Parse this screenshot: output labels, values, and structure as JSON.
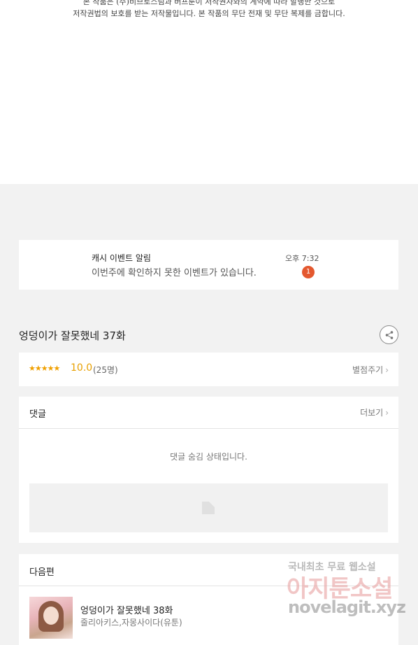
{
  "copyright": {
    "line1": "본 작품은 (주)비브로스팀과 버프툰이 저작권자와의 계약에 따라 발행한 것으로",
    "line2": "저작권법의 보호를 받는 저작물입니다. 본 작품의 무단 전재 및 무단 복제를 금합니다."
  },
  "notification": {
    "title": "캐시 이벤트 알림",
    "body": "이번주에 확인하지 못한 이벤트가 있습니다.",
    "time": "오후 7:32",
    "badge": "1"
  },
  "episode": {
    "title": "엉덩이가 잘못했네 37화",
    "share_icon": "share-icon"
  },
  "rating": {
    "stars": "★★★★★",
    "score": "10.0",
    "count": "(25명)",
    "rate_label": "별점주기",
    "chevron": "›"
  },
  "comments": {
    "heading": "댓글",
    "more_label": "더보기",
    "chevron": "›",
    "hidden_message": "댓글 숨김 상태입니다."
  },
  "next_episode": {
    "heading": "다음편",
    "title": "엉덩이가 잘못했네 38화",
    "author": "줄리아키스,자몽사이다(유툰)"
  },
  "watermark": {
    "line1": "국내최초 무료 웹소설",
    "line2": "아지툰소설",
    "line3": "novelagit.xyz"
  },
  "colors": {
    "badge": "#e4582f",
    "stars": "#f0a000",
    "score": "#e8a000",
    "background": "#f2f2f2"
  }
}
